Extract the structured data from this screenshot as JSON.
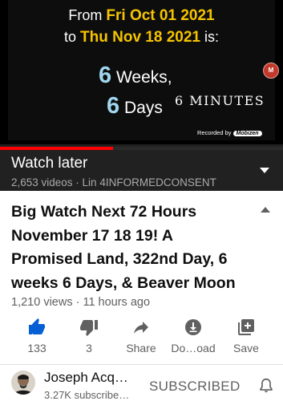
{
  "video": {
    "line1_prefix": "From ",
    "line1_date": "Fri Oct 01 2021",
    "line2_prefix": "to ",
    "line2_date": "Thu Nov 18 2021",
    "line2_suffix": " is:",
    "weeks_num": "6",
    "weeks_label": " Weeks,",
    "days_num": "6",
    "days_label": " Days",
    "minutes": "6 MINUTES",
    "recorded_by": "Recorded by",
    "recorder_app": "Mobizen",
    "progress_fraction": 0.4
  },
  "playlist": {
    "title": "Watch later",
    "subtitle": "2,653 videos · Lin 4INFORMEDCONSENT"
  },
  "video_info": {
    "title": "Big Watch Next 72 Hours November 17 18 19! A Promised Land, 322nd Day, 6 weeks 6 Days, & Beaver Moon",
    "meta": "1,210 views · 11 hours ago"
  },
  "actions": [
    {
      "label": "133",
      "icon": "thumbs-up-icon",
      "active": true
    },
    {
      "label": "3",
      "icon": "thumbs-down-icon",
      "active": false
    },
    {
      "label": "Share",
      "icon": "share-icon",
      "active": false
    },
    {
      "label": "Do…oad",
      "icon": "download-icon",
      "active": false
    },
    {
      "label": "Save",
      "icon": "save-icon",
      "active": false
    }
  ],
  "channel": {
    "name": "Joseph Acq…",
    "subscribers": "3.27K subscribe…",
    "subscribe_state": "SUBSCRIBED"
  },
  "colors": {
    "accent_blue": "#065fd4",
    "highlight_yellow": "#f6c400",
    "progress_red": "#ff0000"
  }
}
